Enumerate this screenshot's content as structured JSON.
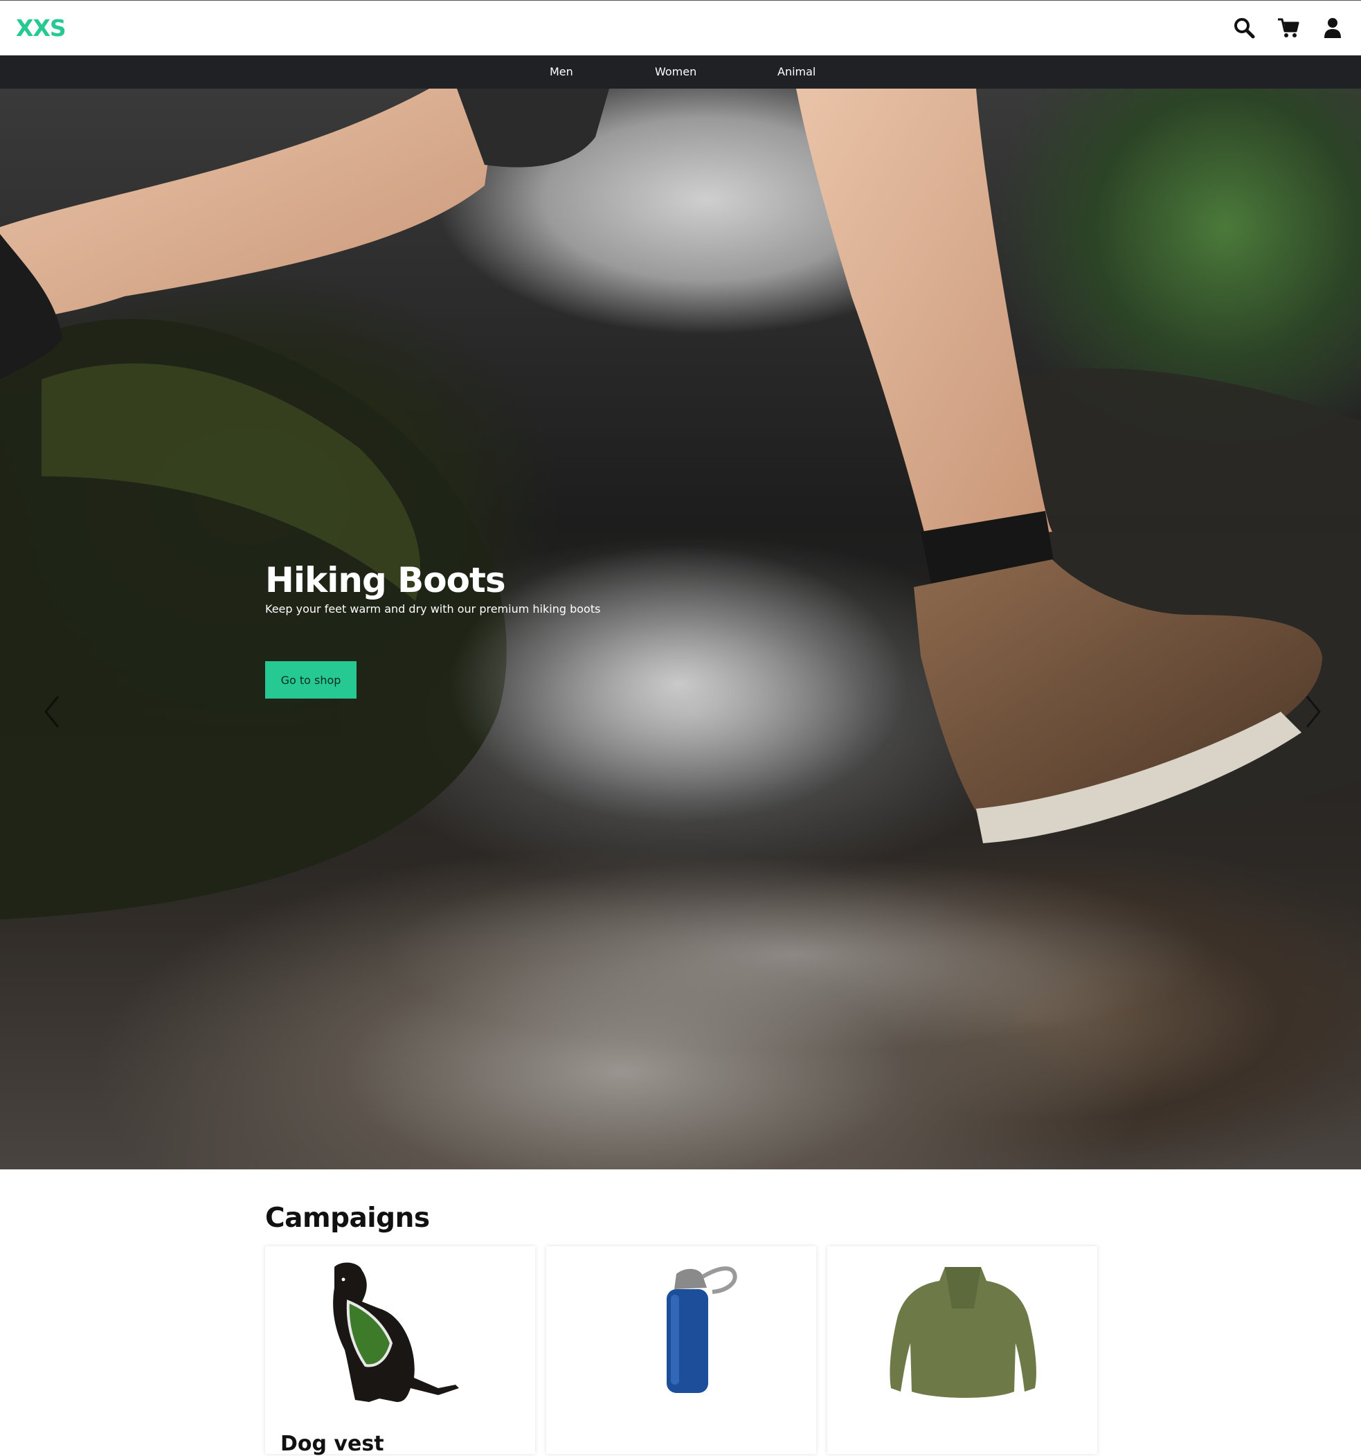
{
  "header": {
    "logo": "XXS",
    "icons": [
      "search-icon",
      "cart-icon",
      "user-icon"
    ]
  },
  "nav": {
    "items": [
      {
        "label": "Men"
      },
      {
        "label": "Women"
      },
      {
        "label": "Animal"
      }
    ]
  },
  "hero": {
    "title": "Hiking Boots",
    "subtitle": "Keep your feet warm and dry with our premium hiking boots",
    "button_label": "Go to shop",
    "slides_count": 3,
    "active_slide": 2
  },
  "campaigns": {
    "title": "Campaigns",
    "cards": [
      {
        "image": "dog-in-green-vest",
        "title": "Dog vest"
      },
      {
        "image": "blue-water-bottle",
        "title": ""
      },
      {
        "image": "green-fleece-jacket",
        "title": ""
      }
    ]
  },
  "colors": {
    "accent": "#27c993",
    "navbar": "#1f2125",
    "background": "#ffffff"
  }
}
